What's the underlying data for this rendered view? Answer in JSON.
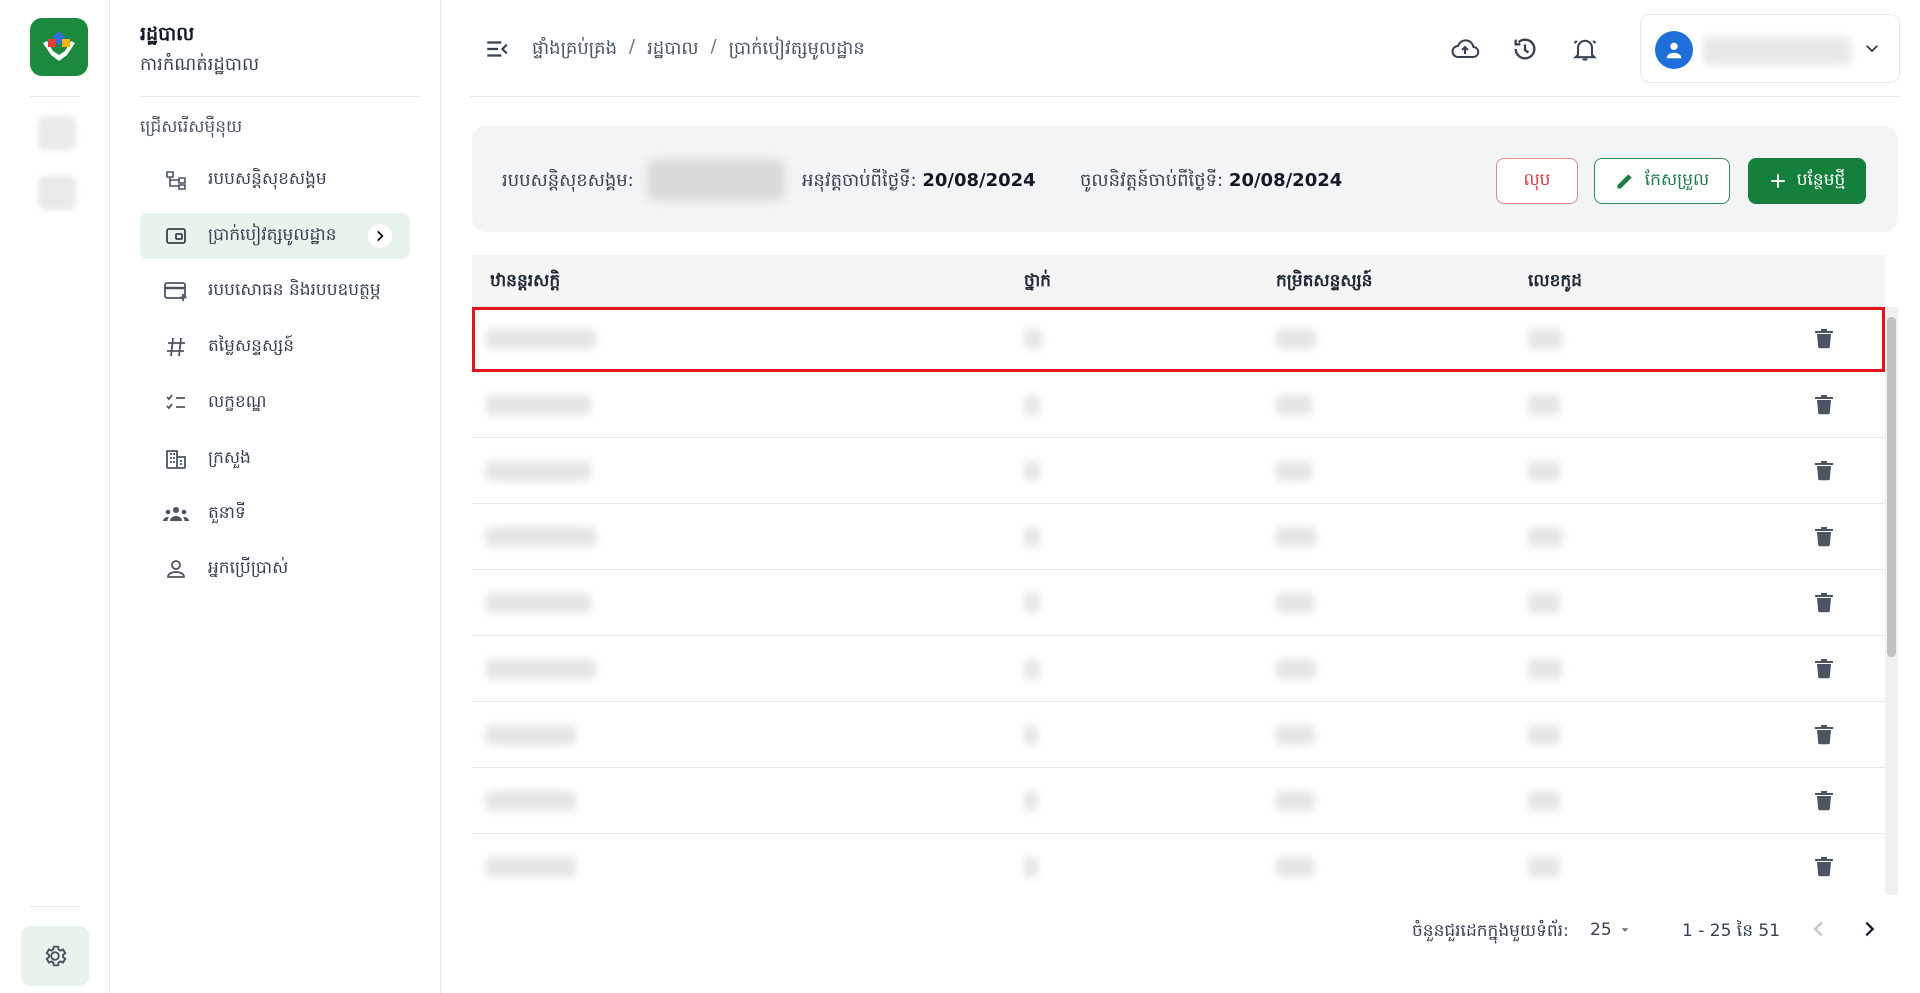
{
  "app": {
    "brand_color": "#1b8a3c",
    "accent_light": "#e8f3ec"
  },
  "sidebar": {
    "title": "រដ្ឋបាល",
    "subtitle": "ការកំណត់រដ្ឋបាល",
    "section_label": "ជ្រើសរើសម៉ឺនុយ",
    "items": [
      {
        "label": "របបសន្តិសុខសង្គម",
        "icon": "hierarchy-icon"
      },
      {
        "label": "ប្រាក់បៀវត្សមូលដ្ឋាន",
        "icon": "wallet-icon",
        "active": true
      },
      {
        "label": "របបសោធន និងរបបឧបត្ថម្ភ",
        "icon": "card-add-icon"
      },
      {
        "label": "តម្លៃសន្ទស្សន៍",
        "icon": "hash-icon"
      },
      {
        "label": "លក្ខខណ្ឌ",
        "icon": "checklist-icon"
      },
      {
        "label": "ក្រសួង",
        "icon": "building-icon"
      },
      {
        "label": "តួនាទី",
        "icon": "group-icon"
      },
      {
        "label": "អ្នកប្រើប្រាស់",
        "icon": "user-icon"
      }
    ]
  },
  "breadcrumb": [
    "ផ្ទាំងគ្រប់គ្រង",
    "រដ្ឋបាល",
    "ប្រាក់បៀវត្សមូលដ្ឋាន"
  ],
  "info": {
    "scheme_label": "របបសន្តិសុខសង្គម:",
    "effective_label": "អនុវត្តចាប់ពីថ្ងៃទី:",
    "effective_date": "20/08/2024",
    "enforce_label": "ចូលនិវត្តន៍ចាប់ពីថ្ងៃទី:",
    "enforce_date": "20/08/2024"
  },
  "buttons": {
    "delete": "លុប",
    "edit": "កែសម្រួល",
    "add": "បន្ថែមថ្មី"
  },
  "table": {
    "headers": [
      "ឋានន្តរសក្តិ",
      "ថ្នាក់",
      "កម្រិតសន្ទស្សន៍",
      "លេខកូដ"
    ],
    "row_count_visible": 9
  },
  "pagination": {
    "rows_per_page_label": "ចំនួនជួរដេកក្នុងមួយទំព័រ:",
    "rows_per_page": "25",
    "range": "1 - 25 នៃ 51"
  }
}
